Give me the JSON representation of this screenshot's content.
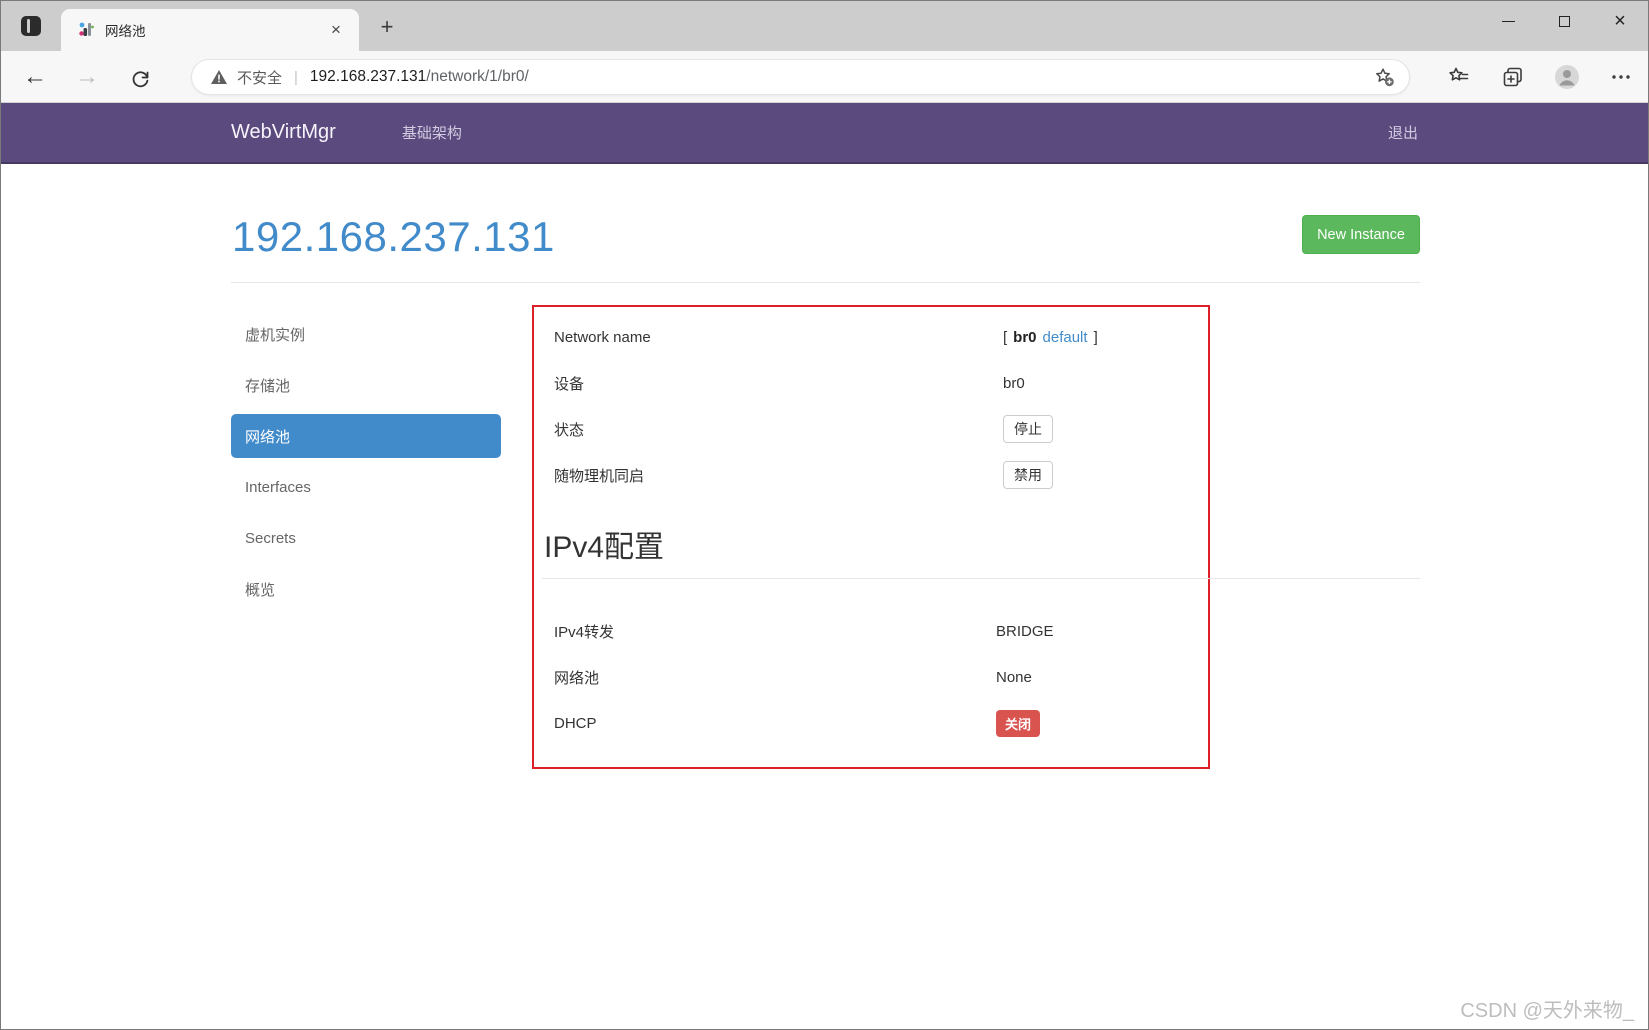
{
  "browser": {
    "tab_title": "网络池",
    "tab_close_glyph": "×",
    "new_tab_glyph": "+",
    "window_close_glyph": "×",
    "back_glyph": "←",
    "forward_glyph": "→",
    "security_text": "不安全",
    "separator": "|",
    "url_host": "192.168.237.131",
    "url_path": "/network/1/br0/",
    "icons": {
      "tab_actions": "tab-layout-square",
      "favicon": "webvirtmgr-logo",
      "back": "left-arrow",
      "forward": "right-arrow",
      "refresh": "circular-arrow",
      "warning": "filled-triangle-exclamation",
      "bookmark": "star-plus",
      "favorites_hub": "star-with-lines",
      "collections": "stacked-squares-plus",
      "profile": "person-circle",
      "more": "ellipsis-dots",
      "minimize": "horizontal-bar",
      "maximize": "square-outline"
    }
  },
  "navbar": {
    "brand": "WebVirtMgr",
    "menu_item": "基础架构",
    "logout": "退出",
    "bg_color": "#5a4a7d"
  },
  "page": {
    "title": "192.168.237.131",
    "new_instance": "New Instance"
  },
  "sidebar": {
    "items": [
      {
        "label": "虚机实例",
        "active": false
      },
      {
        "label": "存储池",
        "active": false
      },
      {
        "label": "网络池",
        "active": true
      },
      {
        "label": "Interfaces",
        "active": false
      },
      {
        "label": "Secrets",
        "active": false
      },
      {
        "label": "概览",
        "active": false
      }
    ]
  },
  "network": {
    "rows": {
      "name": {
        "label": "Network name",
        "open": "[",
        "value": "br0",
        "link": "default",
        "close": "]"
      },
      "device": {
        "label": "设备",
        "value": "br0"
      },
      "state": {
        "label": "状态",
        "button": "停止"
      },
      "autostart": {
        "label": "随物理机同启",
        "button": "禁用"
      }
    },
    "ipv4_heading": "IPv4配置",
    "ipv4_rows": {
      "forward": {
        "label": "IPv4转发",
        "value": "BRIDGE"
      },
      "pool": {
        "label": "网络池",
        "value": "None"
      },
      "dhcp": {
        "label": "DHCP",
        "badge": "关闭"
      }
    }
  },
  "watermark": "CSDN @天外来物_",
  "colors": {
    "accent_blue": "#428bca",
    "success_green": "#5cb85c",
    "danger_red": "#d9534f",
    "annotation_red": "#dd2025",
    "navbar_purple": "#5a4a7d"
  }
}
